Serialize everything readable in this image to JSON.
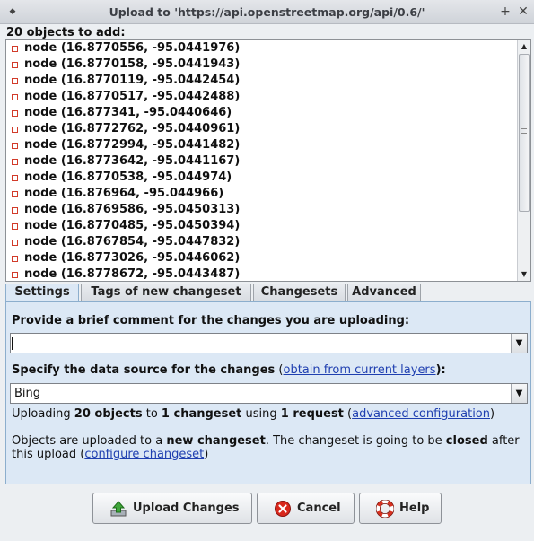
{
  "window": {
    "title": "Upload to 'https://api.openstreetmap.org/api/0.6/'",
    "menu_glyph": "◆",
    "maximize_glyph": "+",
    "close_glyph": "✕"
  },
  "objects": {
    "label": "20 objects to add:",
    "nodes": [
      "node (16.8770556, -95.0441976)",
      "node (16.8770158, -95.0441943)",
      "node (16.8770119, -95.0442454)",
      "node (16.8770517, -95.0442488)",
      "node (16.877341, -95.0440646)",
      "node (16.8772762, -95.0440961)",
      "node (16.8772994, -95.0441482)",
      "node (16.8773642, -95.0441167)",
      "node (16.8770538, -95.044974)",
      "node (16.876964, -95.044966)",
      "node (16.8769586, -95.0450313)",
      "node (16.8770485, -95.0450394)",
      "node (16.8767854, -95.0447832)",
      "node (16.8773026, -95.0446062)",
      "node (16.8778672, -95.0443487)"
    ],
    "scroll_up": "▲",
    "scroll_down": "▼"
  },
  "tabs": [
    {
      "label": "Settings",
      "active": true
    },
    {
      "label": "Tags of new changeset",
      "active": false
    },
    {
      "label": "Changesets",
      "active": false
    },
    {
      "label": "Advanced",
      "active": false
    }
  ],
  "settings": {
    "comment_prompt": "Provide a brief comment for the changes you are uploading:",
    "comment_value": "",
    "dropdown_glyph": "▼",
    "source_prompt": "Specify the data source for the changes",
    "source_paren_open": " (",
    "source_link": "obtain from current layers",
    "source_paren_close": "):",
    "source_value": "Bing",
    "summary": {
      "t1": "Uploading ",
      "b1": "20 objects",
      "t2": " to ",
      "b2": "1 changeset",
      "t3": " using ",
      "b3": "1 request",
      "t4": " (",
      "link": "advanced configuration",
      "t5": ")"
    },
    "changeset_info": {
      "t1": "Objects are uploaded to a ",
      "b1": "new changeset",
      "t2": ". The changeset is going to be ",
      "b2": "closed",
      "t3": " after",
      "line2_t1": "this upload (",
      "line2_link": "configure changeset",
      "line2_t2": ")"
    }
  },
  "buttons": {
    "upload": "Upload Changes",
    "cancel": "Cancel",
    "help": "Help"
  },
  "colors": {
    "panel_bg": "#dce8f5",
    "link": "#1f3fb0",
    "node_icon": "#d23b2a"
  }
}
